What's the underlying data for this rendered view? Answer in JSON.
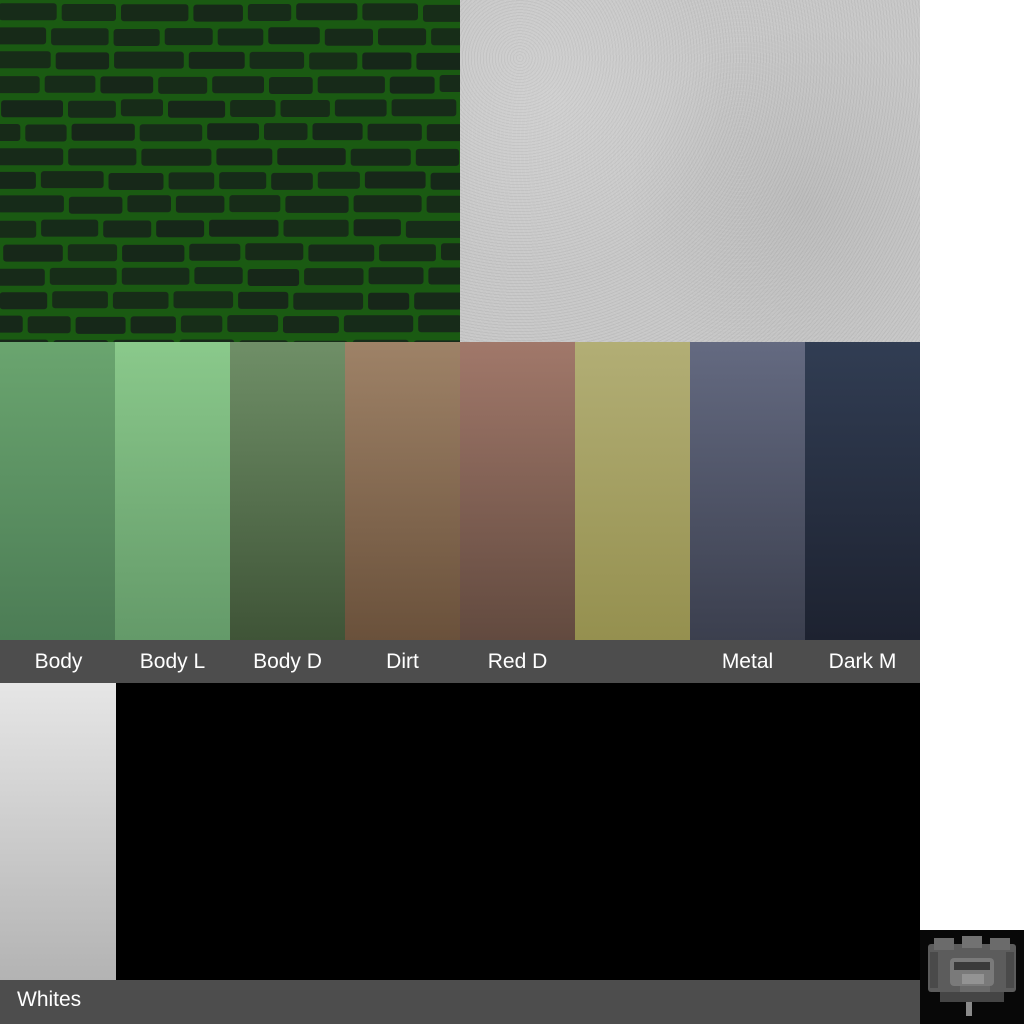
{
  "textures": {
    "brick": {
      "name": "green-brick-texture",
      "mortar_color": "#1a5a12",
      "brick_color": "#17251a"
    },
    "concrete": {
      "name": "concrete-texture",
      "color": "#c8c8c8"
    }
  },
  "swatches": [
    {
      "label": "Body",
      "top": "#6aa56f",
      "bottom": "#4c7c55"
    },
    {
      "label": "Body L",
      "top": "#8ac98b",
      "bottom": "#649a69"
    },
    {
      "label": "Body D",
      "top": "#6f8f67",
      "bottom": "#3f5437"
    },
    {
      "label": "Dirt",
      "top": "#9e8267",
      "bottom": "#6a513b"
    },
    {
      "label": "Red D",
      "top": "#a1786a",
      "bottom": "#624a3f"
    },
    {
      "label": "",
      "top": "#b2ae75",
      "bottom": "#95904f"
    },
    {
      "label": "Metal",
      "top": "#646a81",
      "bottom": "#3b3f4e"
    },
    {
      "label": "Dark M",
      "top": "#313d53",
      "bottom": "#1d2230"
    }
  ],
  "whites": {
    "label": "Whites",
    "top": "#e6e6e6",
    "bottom": "#b3b3b3"
  },
  "thumbnail": {
    "name": "model-thumbnail-icon",
    "body_color": "#5a5a5a"
  }
}
